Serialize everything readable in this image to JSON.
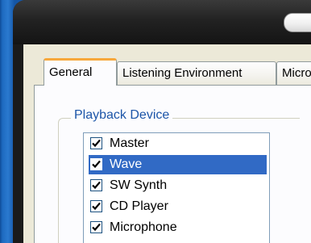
{
  "window": {
    "frame_color": "#1a1a1a",
    "client_color": "#ece9d8"
  },
  "tabs": [
    {
      "label": "General",
      "active": true
    },
    {
      "label": "Listening Environment",
      "active": false
    },
    {
      "label": "Microphone",
      "active": false
    }
  ],
  "playback_device": {
    "legend": "Playback Device",
    "items": [
      {
        "label": "Master",
        "checked": true,
        "selected": false
      },
      {
        "label": "Wave",
        "checked": true,
        "selected": true
      },
      {
        "label": "SW Synth",
        "checked": true,
        "selected": false
      },
      {
        "label": "CD Player",
        "checked": true,
        "selected": false
      },
      {
        "label": "Microphone",
        "checked": true,
        "selected": false
      }
    ]
  },
  "colors": {
    "selection": "#316ac5",
    "active_tab_accent": "#f7a83c",
    "legend_text": "#1c55a8"
  }
}
